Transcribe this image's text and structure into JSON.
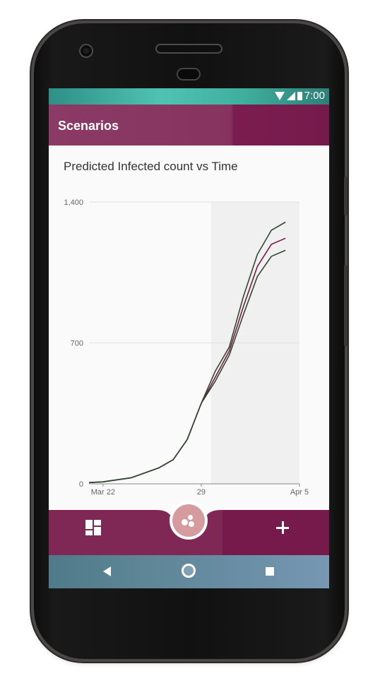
{
  "status_bar": {
    "time": "7:00"
  },
  "app_bar": {
    "title": "Scenarios"
  },
  "chart_title": "Predicted Infected count vs Time",
  "bottom_bar": {
    "dashboard_icon": "dashboard-icon",
    "fab_icon": "bubbles-icon",
    "add_icon": "plus-icon"
  },
  "nav_bar": {
    "back_icon": "back-triangle-icon",
    "home_icon": "home-circle-icon",
    "recent_icon": "recent-square-icon"
  },
  "colors": {
    "primary": "#8b3a66",
    "primary_dark": "#761a4c",
    "fab": "#d59b9f",
    "series_green": "#2e4a2e",
    "series_maroon": "#7a1a45"
  },
  "chart_data": {
    "type": "line",
    "title": "Predicted Infected count vs Time",
    "xlabel": "",
    "ylabel": "",
    "ylim": [
      0,
      1400
    ],
    "y_ticks": [
      "0",
      "700",
      "1,400"
    ],
    "x_tick_labels": [
      "Mar 22",
      "29",
      "Apr 5"
    ],
    "x": [
      "Mar 21",
      "Mar 22",
      "Mar 23",
      "Mar 24",
      "Mar 25",
      "Mar 26",
      "Mar 27",
      "Mar 28",
      "Mar 29",
      "Mar 30",
      "Mar 31",
      "Apr 1",
      "Apr 2",
      "Apr 3",
      "Apr 4",
      "Apr 5"
    ],
    "highlight_from": "Mar 30",
    "grid": true,
    "series": [
      {
        "color": "#2e4a2e",
        "values": [
          6,
          10,
          20,
          30,
          55,
          80,
          120,
          220,
          400,
          560,
          680,
          930,
          1140,
          1260,
          1300
        ]
      },
      {
        "color": "#7a1a45",
        "values": [
          6,
          10,
          20,
          30,
          55,
          80,
          120,
          220,
          400,
          530,
          660,
          880,
          1080,
          1190,
          1220
        ]
      },
      {
        "color": "#2e4a2e",
        "values": [
          6,
          10,
          20,
          30,
          55,
          80,
          120,
          220,
          400,
          510,
          640,
          840,
          1030,
          1130,
          1160
        ]
      }
    ]
  }
}
